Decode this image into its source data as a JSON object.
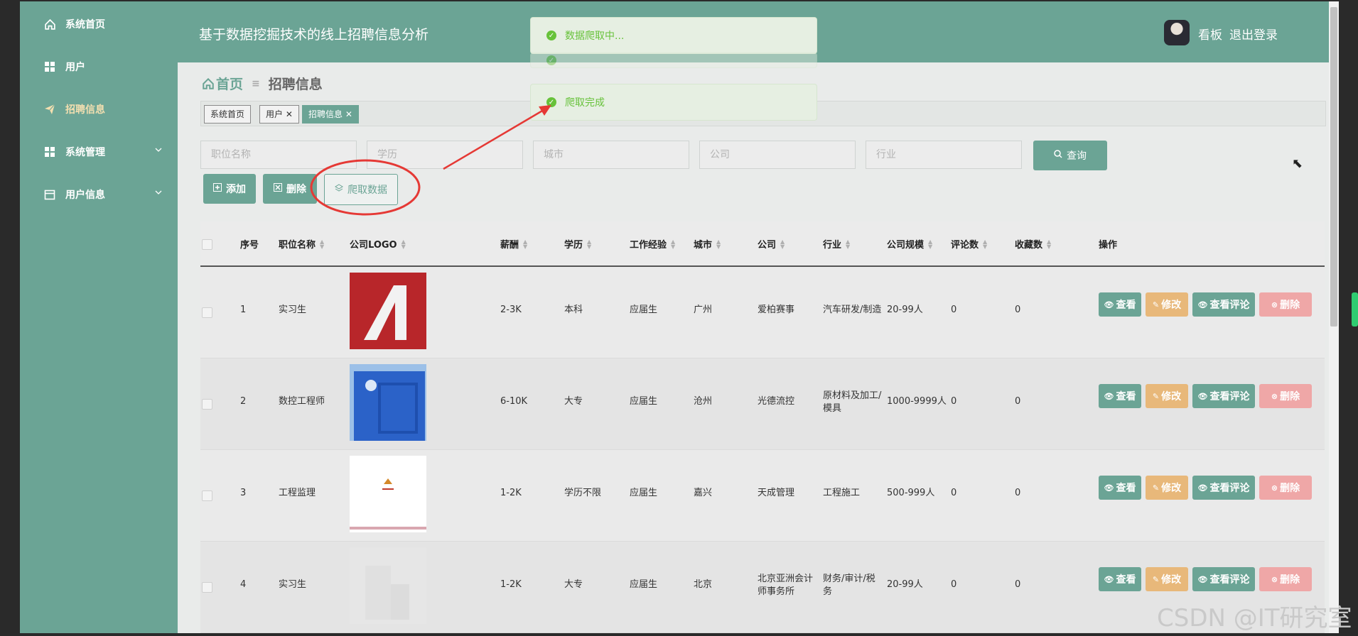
{
  "sidebar": {
    "items": [
      {
        "label": "系统首页",
        "icon": "home-icon"
      },
      {
        "label": "用户",
        "icon": "grid-icon"
      },
      {
        "label": "招聘信息",
        "icon": "paper-plane-icon",
        "active": true
      },
      {
        "label": "系统管理",
        "icon": "grid-icon"
      },
      {
        "label": "用户信息",
        "icon": "calendar-icon"
      }
    ]
  },
  "header": {
    "title": "基于数据挖掘技术的线上招聘信息分析",
    "user": "看板",
    "logout": "退出登录"
  },
  "breadcrumb": {
    "home": "首页",
    "current": "招聘信息"
  },
  "tags": [
    "系统首页",
    "用户",
    "招聘信息"
  ],
  "toasts": [
    "数据爬取中...",
    "爬取完成"
  ],
  "search": {
    "position_placeholder": "职位名称",
    "education_placeholder": "学历",
    "city_placeholder": "城市",
    "company_placeholder": "公司",
    "industry_placeholder": "行业",
    "query_label": "查询"
  },
  "toolbar": {
    "add": "添加",
    "delete": "删除",
    "crawl": "爬取数据"
  },
  "table": {
    "headers": [
      "序号",
      "职位名称",
      "公司LOGO",
      "薪酬",
      "学历",
      "工作经验",
      "城市",
      "公司",
      "行业",
      "公司规模",
      "评论数",
      "收藏数",
      "操作"
    ],
    "rows": [
      {
        "no": "1",
        "title": "实习生",
        "salary": "2-3K",
        "edu": "本科",
        "exp": "应届生",
        "city": "广州",
        "company": [
          "爱柏赛事"
        ],
        "industry": [
          "汽车研发/制造"
        ],
        "size": "20-99人",
        "comments": "0",
        "favs": "0",
        "logo_color": "#b8262a"
      },
      {
        "no": "2",
        "title": "数控工程师",
        "salary": "6-10K",
        "edu": "大专",
        "exp": "应届生",
        "city": "沧州",
        "company": [
          "光德流控"
        ],
        "industry": [
          "原材料及加工/",
          "模具"
        ],
        "size": "1000-9999人",
        "comments": "0",
        "favs": "0",
        "logo_color": "#2b62c8"
      },
      {
        "no": "3",
        "title": "工程监理",
        "salary": "1-2K",
        "edu": "学历不限",
        "exp": "应届生",
        "city": "嘉兴",
        "company": [
          "天成管理"
        ],
        "industry": [
          "工程施工"
        ],
        "size": "500-999人",
        "comments": "0",
        "favs": "0",
        "logo_color": "#ffffff"
      },
      {
        "no": "4",
        "title": "实习生",
        "salary": "1-2K",
        "edu": "大专",
        "exp": "应届生",
        "city": "北京",
        "company": [
          "北京亚洲会计",
          "师事务所"
        ],
        "industry": [
          "财务/审计/税",
          "务"
        ],
        "size": "20-99人",
        "comments": "0",
        "favs": "0",
        "logo_color": "#e0e0e0"
      }
    ],
    "actions": {
      "view": "查看",
      "edit": "修改",
      "comments": "查看评论",
      "delete": "删除"
    }
  },
  "watermark": "CSDN @IT研究室",
  "colors": {
    "primary": "#6ba495",
    "edit": "#e8b87a",
    "delete": "#efa7a7",
    "toast": "#67c23a",
    "annotation": "#e53935"
  }
}
